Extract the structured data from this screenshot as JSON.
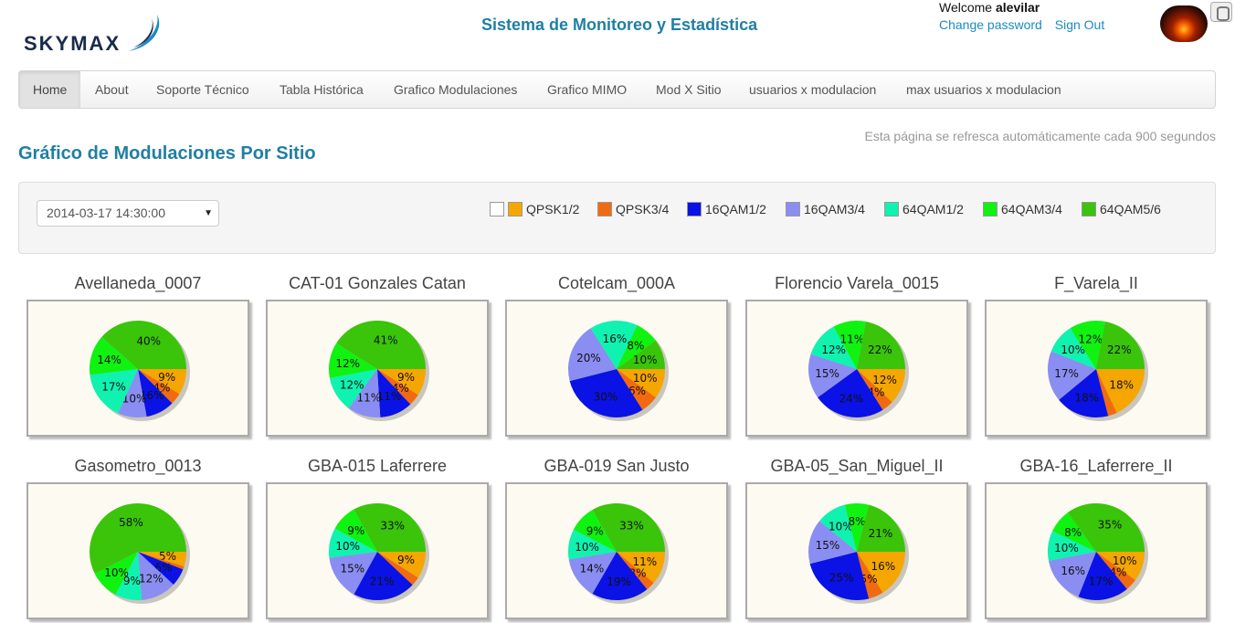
{
  "header": {
    "logo_text": "SKYMAX",
    "site_title": "Sistema de Monitoreo y Estadística",
    "welcome_prefix": "Welcome",
    "username": "alevilar",
    "change_password": "Change password",
    "sign_out": "Sign Out"
  },
  "nav": {
    "items": [
      {
        "label": "Home",
        "active": true
      },
      {
        "label": "About"
      },
      {
        "label": "Soporte Técnico"
      },
      {
        "label": "Tabla Histórica"
      },
      {
        "label": "Grafico Modulaciones"
      },
      {
        "label": "Grafico MIMO"
      },
      {
        "label": "Mod X Sitio"
      },
      {
        "label": "usuarios x modulacion"
      },
      {
        "label": "max usuarios x modulacion"
      }
    ]
  },
  "refresh_text": "Esta página se refresca automáticamente cada 900 segundos",
  "page_title": "Gráfico de Modulaciones Por Sitio",
  "filter": {
    "selected_date": "2014-03-17 14:30:00"
  },
  "legend": [
    {
      "label": "QPSK1/2",
      "color": "#f5a600"
    },
    {
      "label": "QPSK3/4",
      "color": "#f26a10"
    },
    {
      "label": "16QAM1/2",
      "color": "#0a12e6"
    },
    {
      "label": "16QAM3/4",
      "color": "#8a8ef2"
    },
    {
      "label": "64QAM1/2",
      "color": "#10f2b0"
    },
    {
      "label": "64QAM3/4",
      "color": "#10f210"
    },
    {
      "label": "64QAM5/6",
      "color": "#3ac40a"
    }
  ],
  "chart_data": [
    {
      "type": "pie",
      "title": "Avellaneda_0007",
      "categories": [
        "QPSK1/2",
        "QPSK3/4",
        "16QAM1/2",
        "16QAM3/4",
        "64QAM1/2",
        "64QAM3/4",
        "64QAM5/6"
      ],
      "values": [
        9,
        4,
        10,
        10,
        17,
        14,
        40
      ],
      "labels": [
        "9%",
        "4%",
        "16%",
        "10%",
        "17%",
        "14%",
        "40%"
      ]
    },
    {
      "type": "pie",
      "title": "CAT-01 Gonzales Catan",
      "categories": [
        "QPSK1/2",
        "QPSK3/4",
        "16QAM1/2",
        "16QAM3/4",
        "64QAM1/2",
        "64QAM3/4",
        "64QAM5/6"
      ],
      "values": [
        9,
        4,
        11,
        11,
        12,
        12,
        41
      ],
      "labels": [
        "9%",
        "4%",
        "11%",
        "11%",
        "12%",
        "12%",
        "41%"
      ]
    },
    {
      "type": "pie",
      "title": "Cotelcam_000A",
      "categories": [
        "QPSK1/2",
        "QPSK3/4",
        "16QAM1/2",
        "16QAM3/4",
        "64QAM1/2",
        "64QAM3/4",
        "64QAM5/6"
      ],
      "values": [
        10,
        6,
        30,
        20,
        16,
        8,
        10
      ],
      "labels": [
        "10%",
        "6%",
        "30%",
        "20%",
        "16%",
        "8%",
        "10%"
      ]
    },
    {
      "type": "pie",
      "title": "Florencio Varela_0015",
      "categories": [
        "QPSK1/2",
        "QPSK3/4",
        "16QAM1/2",
        "16QAM3/4",
        "64QAM1/2",
        "64QAM3/4",
        "64QAM5/6"
      ],
      "values": [
        12,
        4,
        24,
        15,
        12,
        11,
        22
      ],
      "labels": [
        "12%",
        "4%",
        "24%",
        "15%",
        "12%",
        "11%",
        "22%"
      ]
    },
    {
      "type": "pie",
      "title": "F_Varela_II",
      "categories": [
        "QPSK1/2",
        "QPSK3/4",
        "16QAM1/2",
        "16QAM3/4",
        "64QAM1/2",
        "64QAM3/4",
        "64QAM5/6"
      ],
      "values": [
        18,
        3,
        18,
        17,
        10,
        12,
        22
      ],
      "labels": [
        "18%",
        "",
        "18%",
        "17%",
        "10%",
        "12%",
        "22%"
      ]
    },
    {
      "type": "pie",
      "title": "Gasometro_0013",
      "categories": [
        "QPSK1/2",
        "QPSK3/4",
        "16QAM1/2",
        "16QAM3/4",
        "64QAM1/2",
        "64QAM3/4",
        "64QAM5/6"
      ],
      "values": [
        5,
        1,
        6,
        12,
        9,
        10,
        58
      ],
      "labels": [
        "5%",
        "",
        "6%",
        "12%",
        "9%",
        "10%",
        "58%"
      ]
    },
    {
      "type": "pie",
      "title": "GBA-015 Laferrere",
      "categories": [
        "QPSK1/2",
        "QPSK3/4",
        "16QAM1/2",
        "16QAM3/4",
        "64QAM1/2",
        "64QAM3/4",
        "64QAM5/6"
      ],
      "values": [
        9,
        3,
        21,
        15,
        10,
        9,
        33
      ],
      "labels": [
        "9%",
        "",
        "21%",
        "15%",
        "10%",
        "9%",
        "33%"
      ]
    },
    {
      "type": "pie",
      "title": "GBA-019 San Justo",
      "categories": [
        "QPSK1/2",
        "QPSK3/4",
        "16QAM1/2",
        "16QAM3/4",
        "64QAM1/2",
        "64QAM3/4",
        "64QAM5/6"
      ],
      "values": [
        11,
        3,
        19,
        14,
        10,
        9,
        33
      ],
      "labels": [
        "11%",
        "3%",
        "19%",
        "14%",
        "10%",
        "9%",
        "33%"
      ]
    },
    {
      "type": "pie",
      "title": "GBA-05_San_Miguel_II",
      "categories": [
        "QPSK1/2",
        "QPSK3/4",
        "16QAM1/2",
        "16QAM3/4",
        "64QAM1/2",
        "64QAM3/4",
        "64QAM5/6"
      ],
      "values": [
        16,
        5,
        25,
        15,
        10,
        8,
        21
      ],
      "labels": [
        "16%",
        "5%",
        "25%",
        "15%",
        "10%",
        "8%",
        "21%"
      ]
    },
    {
      "type": "pie",
      "title": "GBA-16_Laferrere_II",
      "categories": [
        "QPSK1/2",
        "QPSK3/4",
        "16QAM1/2",
        "16QAM3/4",
        "64QAM1/2",
        "64QAM3/4",
        "64QAM5/6"
      ],
      "values": [
        10,
        4,
        17,
        16,
        10,
        8,
        35
      ],
      "labels": [
        "10%",
        "4%",
        "17%",
        "16%",
        "10%",
        "8%",
        "35%"
      ]
    }
  ]
}
